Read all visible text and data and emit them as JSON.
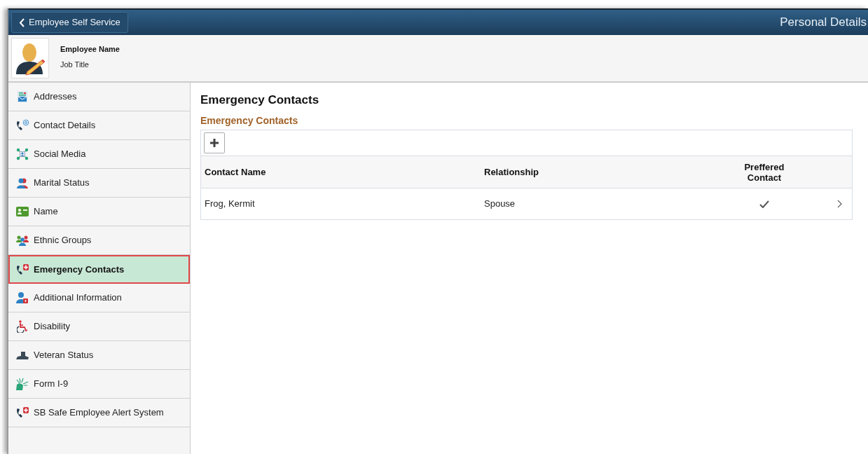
{
  "header": {
    "back_button": "Employee Self Service",
    "title": "Personal Details"
  },
  "profile": {
    "name": "Employee Name",
    "job_title": "Job Title"
  },
  "sidebar": {
    "items": [
      {
        "label": "Addresses",
        "selected": false
      },
      {
        "label": "Contact Details",
        "selected": false
      },
      {
        "label": "Social Media",
        "selected": false
      },
      {
        "label": "Marital Status",
        "selected": false
      },
      {
        "label": "Name",
        "selected": false
      },
      {
        "label": "Ethnic Groups",
        "selected": false
      },
      {
        "label": "Emergency Contacts",
        "selected": true
      },
      {
        "label": "Additional Information",
        "selected": false
      },
      {
        "label": "Disability",
        "selected": false
      },
      {
        "label": "Veteran Status",
        "selected": false
      },
      {
        "label": "Form I-9",
        "selected": false
      },
      {
        "label": "SB Safe Employee Alert System",
        "selected": false
      }
    ]
  },
  "content": {
    "title": "Emergency Contacts",
    "section_title": "Emergency Contacts",
    "table": {
      "columns": [
        "Contact Name",
        "Relationship",
        "Preffered Contact"
      ],
      "rows": [
        {
          "contact_name": "Frog, Kermit",
          "relationship": "Spouse",
          "preferred": true
        }
      ]
    }
  }
}
